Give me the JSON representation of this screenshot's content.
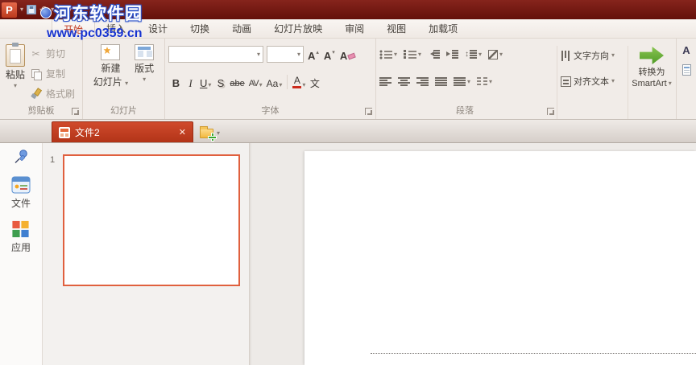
{
  "watermark": {
    "site_name": "河东软件园",
    "site_url": "www.pc0359.cn"
  },
  "quick_access": {
    "logo_letter": "P"
  },
  "glyphs": {
    "dropdown": "▾",
    "up_small": "▴",
    "undo": "↶",
    "redo": "↷",
    "scissors": "✂",
    "close": "✕",
    "updown": "↕"
  },
  "tabs": [
    {
      "label": "开始",
      "active": true
    },
    {
      "label": "插入",
      "active": false
    },
    {
      "label": "设计",
      "active": false
    },
    {
      "label": "切换",
      "active": false
    },
    {
      "label": "动画",
      "active": false
    },
    {
      "label": "幻灯片放映",
      "active": false
    },
    {
      "label": "审阅",
      "active": false
    },
    {
      "label": "视图",
      "active": false
    },
    {
      "label": "加载项",
      "active": false
    }
  ],
  "ribbon": {
    "clipboard": {
      "group": "剪贴板",
      "paste": "粘贴",
      "cut": "剪切",
      "copy": "复制",
      "format_painter": "格式刷"
    },
    "slides": {
      "group": "幻灯片",
      "new_slide_line1": "新建",
      "new_slide_line2": "幻灯片",
      "layout": "版式"
    },
    "font": {
      "group": "字体",
      "name_value": "",
      "size_value": "",
      "grow": "A",
      "shrink": "A",
      "clear": "A",
      "bold": "B",
      "italic": "I",
      "underline": "U",
      "shadow": "S",
      "strike": "abe",
      "spacing": "AV",
      "case": "Aa",
      "color": "A",
      "phonetic": "文"
    },
    "paragraph": {
      "group": "段落",
      "text_direction": "文字方向",
      "align_text": "对齐文本",
      "smartart_line1": "转换为",
      "smartart_line2": "SmartArt"
    }
  },
  "task_panes": {
    "styles_letter": "A"
  },
  "doc_tabs": {
    "active": "文件2"
  },
  "sidebar": {
    "file": "文件",
    "apps": "应用"
  },
  "slides_panel": {
    "slide_number": "1"
  },
  "colors": {
    "titlebar": "#6e120a",
    "accent_tab": "#c23a21",
    "doc_tab": "#b23418",
    "thumbnail_border": "#e0603e",
    "watermark_blue": "#1733cf",
    "smartart_green": "#4e9a26"
  }
}
